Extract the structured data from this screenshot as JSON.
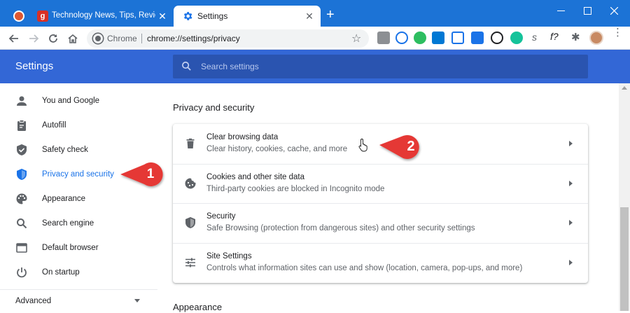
{
  "tabs": [
    {
      "title": "",
      "icon": "duckduckgo-icon"
    },
    {
      "title": "Technology News, Tips, Reviews,",
      "icon": "gotechtips-icon"
    },
    {
      "title": "Settings",
      "icon": "gear-icon",
      "active": true
    }
  ],
  "address": {
    "site_label": "Chrome",
    "url": "chrome://settings/privacy"
  },
  "header": {
    "title": "Settings",
    "search_placeholder": "Search settings"
  },
  "sidebar": {
    "items": [
      {
        "label": "You and Google",
        "icon": "person-icon"
      },
      {
        "label": "Autofill",
        "icon": "clipboard-icon"
      },
      {
        "label": "Safety check",
        "icon": "shield-check-icon"
      },
      {
        "label": "Privacy and security",
        "icon": "shield-icon",
        "active": true
      },
      {
        "label": "Appearance",
        "icon": "palette-icon"
      },
      {
        "label": "Search engine",
        "icon": "search-icon"
      },
      {
        "label": "Default browser",
        "icon": "browser-icon"
      },
      {
        "label": "On startup",
        "icon": "power-icon"
      }
    ],
    "advanced_label": "Advanced"
  },
  "main": {
    "section_title": "Privacy and security",
    "rows": [
      {
        "title": "Clear browsing data",
        "subtitle": "Clear history, cookies, cache, and more",
        "icon": "trash-icon"
      },
      {
        "title": "Cookies and other site data",
        "subtitle": "Third-party cookies are blocked in Incognito mode",
        "icon": "cookie-icon"
      },
      {
        "title": "Security",
        "subtitle": "Safe Browsing (protection from dangerous sites) and other security settings",
        "icon": "shield-icon"
      },
      {
        "title": "Site Settings",
        "subtitle": "Controls what information sites can use and show (location, camera, pop-ups, and more)",
        "icon": "tune-icon"
      }
    ],
    "next_section_title": "Appearance"
  },
  "callouts": [
    {
      "label": "1"
    },
    {
      "label": "2"
    }
  ],
  "colors": {
    "tabstrip": "#1c73d6",
    "header": "#3367d6",
    "accent": "#1a73e8",
    "callout": "#e53935"
  }
}
